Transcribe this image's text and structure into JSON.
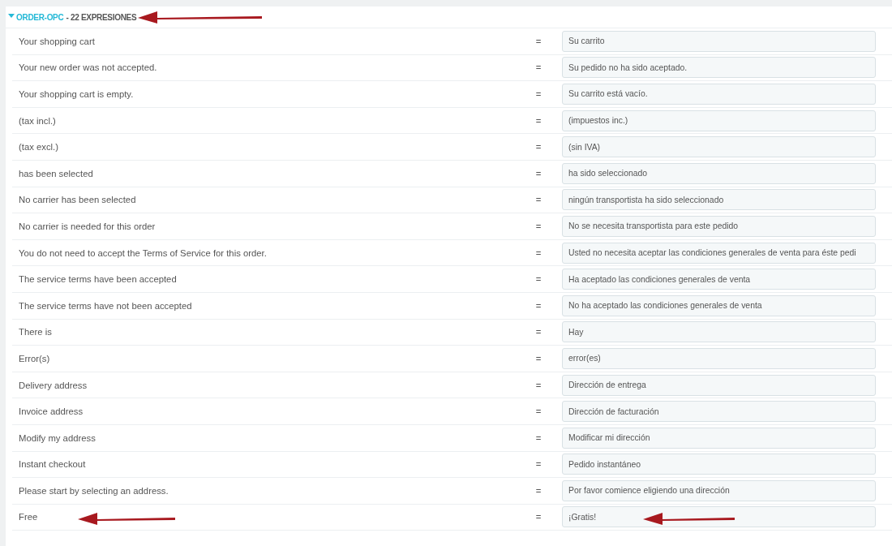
{
  "section": {
    "title": "ORDER-OPC",
    "count": "- 22 EXPRESIONES",
    "expanded": true,
    "pointed": true
  },
  "rows": [
    {
      "source": "Your shopping cart",
      "sign": "=",
      "value": "Su carrito",
      "pointed": false
    },
    {
      "source": "Your new order was not accepted.",
      "sign": "=",
      "value": "Su pedido no ha sido aceptado.",
      "pointed": false
    },
    {
      "source": "Your shopping cart is empty.",
      "sign": "=",
      "value": "Su carrito está vacío.",
      "pointed": false
    },
    {
      "source": "(tax incl.)",
      "sign": "=",
      "value": "(impuestos inc.)",
      "pointed": false
    },
    {
      "source": "(tax excl.)",
      "sign": "=",
      "value": "(sin IVA)",
      "pointed": false
    },
    {
      "source": "has been selected",
      "sign": "=",
      "value": "ha sido seleccionado",
      "pointed": false
    },
    {
      "source": "No carrier has been selected",
      "sign": "=",
      "value": "ningún transportista ha sido seleccionado",
      "pointed": false
    },
    {
      "source": "No carrier is needed for this order",
      "sign": "=",
      "value": "No se necesita transportista para este pedido",
      "pointed": false
    },
    {
      "source": "You do not need to accept the Terms of Service for this order.",
      "sign": "=",
      "value": "Usted no necesita aceptar las condiciones generales de venta para éste pedi",
      "pointed": false
    },
    {
      "source": "The service terms have been accepted",
      "sign": "=",
      "value": "Ha aceptado las condiciones generales de venta",
      "pointed": false
    },
    {
      "source": "The service terms have not been accepted",
      "sign": "=",
      "value": "No ha aceptado las condiciones generales de venta",
      "pointed": false
    },
    {
      "source": "There is",
      "sign": "=",
      "value": "Hay",
      "pointed": false
    },
    {
      "source": "Error(s)",
      "sign": "=",
      "value": "error(es)",
      "pointed": false
    },
    {
      "source": "Delivery address",
      "sign": "=",
      "value": "Dirección de entrega",
      "pointed": false
    },
    {
      "source": "Invoice address",
      "sign": "=",
      "value": "Dirección de facturación",
      "pointed": false
    },
    {
      "source": "Modify my address",
      "sign": "=",
      "value": "Modificar mi dirección",
      "pointed": false
    },
    {
      "source": "Instant checkout",
      "sign": "=",
      "value": "Pedido instantáneo",
      "pointed": false
    },
    {
      "source": "Please start by selecting an address.",
      "sign": "=",
      "value": "Por favor comience eligiendo una dirección",
      "pointed": false
    },
    {
      "source": "Free",
      "sign": "=",
      "value": "¡Gratis!",
      "pointed": true
    }
  ]
}
